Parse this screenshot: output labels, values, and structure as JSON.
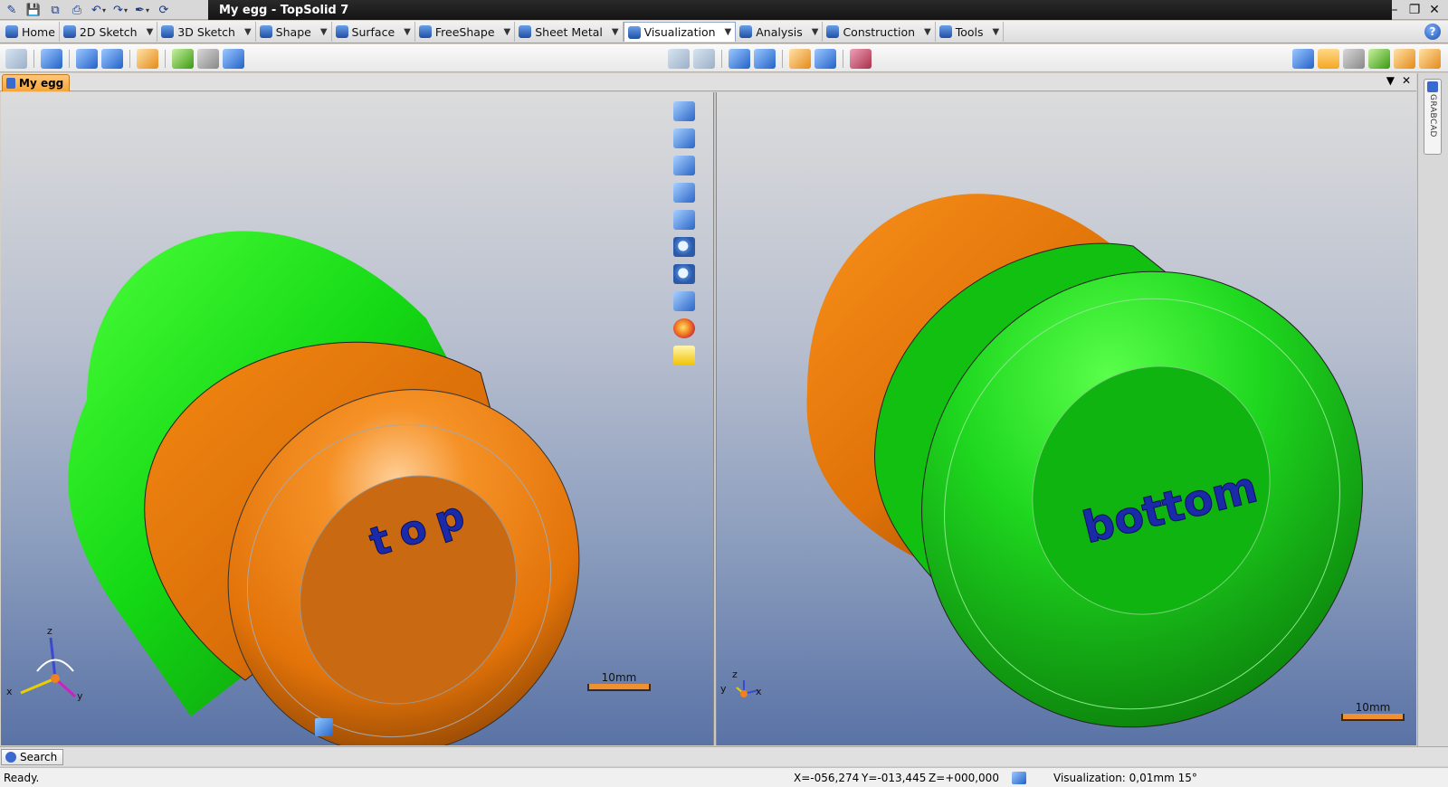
{
  "window": {
    "title": "My egg - TopSolid 7",
    "controls": [
      "minimize-icon",
      "restore-icon",
      "close-icon"
    ]
  },
  "quick_access": [
    "app-logo-icon",
    "save-icon",
    "save-all-icon",
    "print-icon",
    "undo-icon",
    "redo-icon",
    "pen-icon",
    "refresh-icon"
  ],
  "ribbon": {
    "tabs": [
      {
        "label": "Home",
        "icon": "home-icon"
      },
      {
        "label": "2D Sketch",
        "icon": "sketch-2d-icon"
      },
      {
        "label": "3D Sketch",
        "icon": "sketch-3d-icon"
      },
      {
        "label": "Shape",
        "icon": "shape-icon"
      },
      {
        "label": "Surface",
        "icon": "surface-icon"
      },
      {
        "label": "FreeShape",
        "icon": "freeshape-icon"
      },
      {
        "label": "Sheet Metal",
        "icon": "sheet-metal-icon"
      },
      {
        "label": "Visualization",
        "icon": "visualization-icon",
        "active": true
      },
      {
        "label": "Analysis",
        "icon": "analysis-icon"
      },
      {
        "label": "Construction",
        "icon": "construction-icon"
      },
      {
        "label": "Tools",
        "icon": "tools-icon"
      }
    ],
    "help_label": "?"
  },
  "document": {
    "tab_label": "My egg",
    "controls": [
      "dropdown-icon",
      "close-icon"
    ]
  },
  "sidebar": {
    "grabcad_label": "GRABCAD"
  },
  "viewport_left": {
    "text_label": "top",
    "scale_label": "10mm",
    "axes": {
      "x": "x",
      "y": "y",
      "z": "z"
    }
  },
  "viewport_right": {
    "text_label": "bottom",
    "scale_label": "10mm",
    "axes": {
      "x": "x",
      "y": "y",
      "z": "z"
    }
  },
  "colors": {
    "accent_orange": "#f58a10",
    "accent_green": "#1fd81f",
    "text_blue": "#1a2aa8"
  },
  "search": {
    "label": "Search"
  },
  "status": {
    "ready": "Ready.",
    "x": "X=-056,274",
    "y": "Y=-013,445",
    "z": "Z=+000,000",
    "visualization": "Visualization: 0,01mm 15°"
  }
}
